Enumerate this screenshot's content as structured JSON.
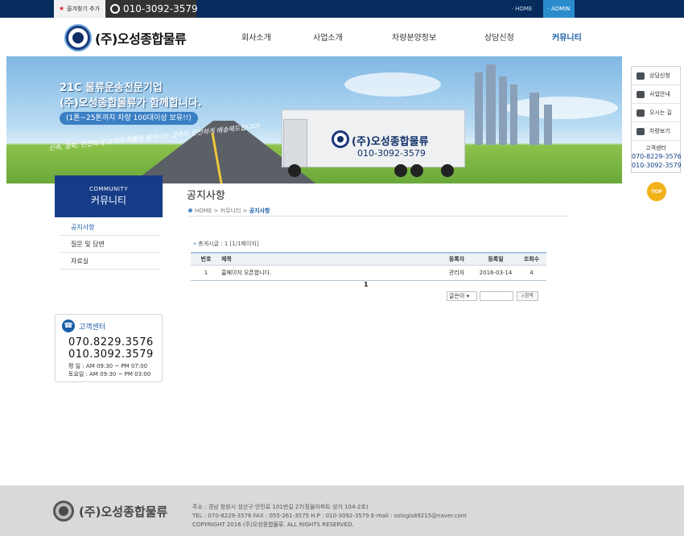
{
  "topbar": {
    "bookmark_label": "즐겨찾기 추가",
    "phone": "010-3092-3579",
    "home_label": "· HOME",
    "admin_label": "· ADMIN"
  },
  "header": {
    "logo_text": "(주)오성종합물류",
    "nav": [
      "회사소개",
      "사업소개",
      "차량분양정보",
      "상담신청",
      "커뮤니티"
    ]
  },
  "banner": {
    "line1": "21C 물류운송전문기업",
    "line2": "(주)오성종합물류가 함께합니다.",
    "line3": "(1톤~25톤까지 차량 100대이상 보유!!)",
    "line4": "신속, 정확, 안전하게 고객의 화물을 원하시는 곳까지 안전하게 배송해드립니다!",
    "truck_name": "(주)오성종합물류",
    "truck_phone": "010-3092-3579"
  },
  "quick_menu": {
    "items": [
      "상담신청",
      "사업안내",
      "오시는 길",
      "차량보기"
    ],
    "cs_title": "고객센터",
    "cs_phone1": "070-8229-3576",
    "cs_phone2": "010-3092-3579",
    "top_label": "TOP"
  },
  "sidebar": {
    "title_en": "COMMUNITY",
    "title_ko": "커뮤니티",
    "items": [
      "공지사항",
      "질문 및 답변",
      "자료실"
    ]
  },
  "cs_box": {
    "title": "고객센터",
    "phone1": "070.8229.3576",
    "phone2": "010.3092.3579",
    "hours_weekday": "평    일 : AM 09:30 ~ PM 07:00",
    "hours_sat": "토요일 : AM 09:30 ~ PM 03:00"
  },
  "content": {
    "title": "공지사항",
    "breadcrumb_home": "HOME",
    "breadcrumb_mid": "커뮤니티",
    "breadcrumb_cur": "공지사항",
    "total": "총게시글 : 1 [1/1페이지]",
    "headers": [
      "번호",
      "제목",
      "등록자",
      "등록일",
      "조회수"
    ],
    "rows": [
      {
        "num": "1",
        "title": "홈페이지 오픈합니다.",
        "writer": "관리자",
        "date": "2016-03-14",
        "views": "4"
      }
    ],
    "page": "1",
    "search_option": "글쓴이",
    "search_button": "검색"
  },
  "footer": {
    "logo_text": "(주)오성종합물류",
    "address": "주소 : 경남 창원시 성산구 안민로 101번길 27(정율아파트 상가 104-2호)",
    "contacts": "TEL : 070-8229-3576     FAX  :  055-261-3575     H.P : 010-3092-3579     E-mail : oslogis89215@naver.com",
    "copyright": "COPYRIGHT 2016 (주)오성종합물류. ALL RIGHTS RESERVED."
  }
}
